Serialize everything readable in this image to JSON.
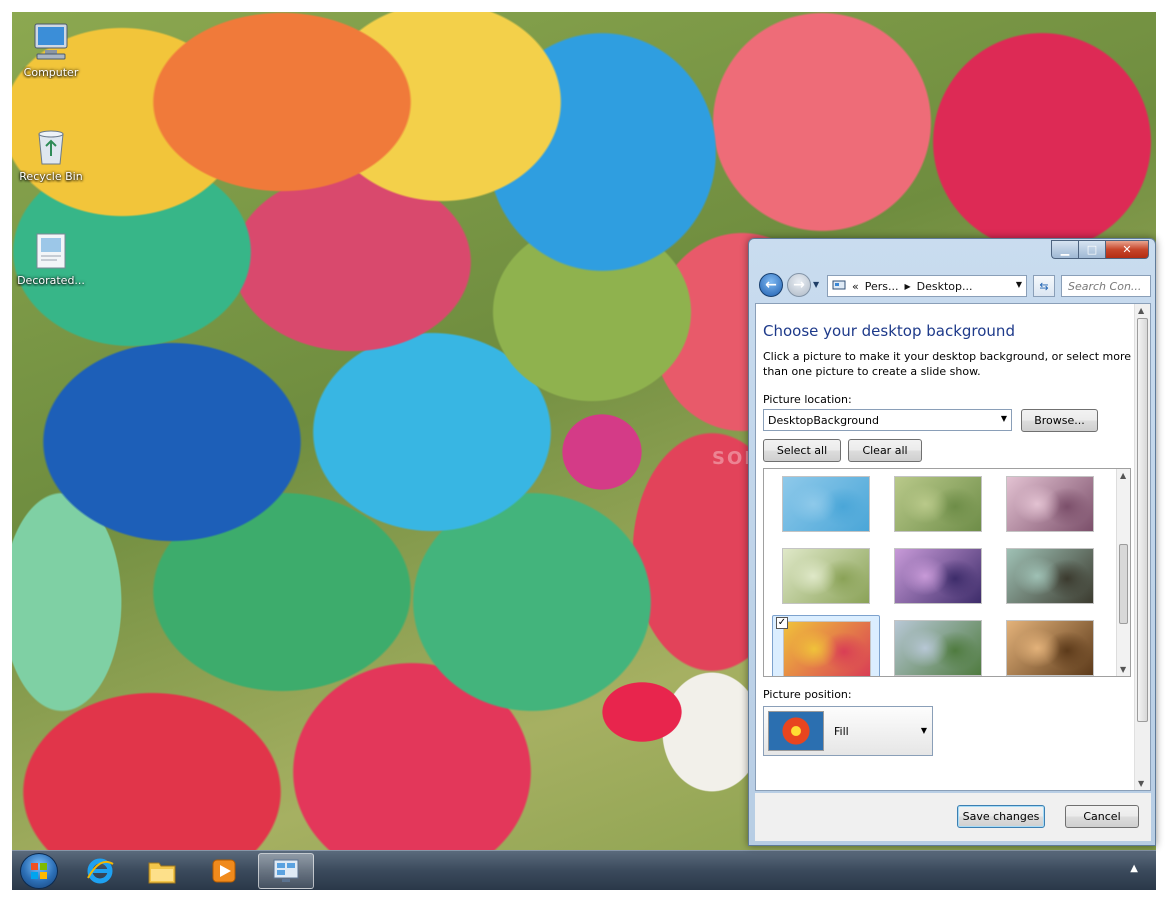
{
  "desktop": {
    "icons": [
      {
        "label": "Computer",
        "icon": "computer-icon"
      },
      {
        "label": "Recycle Bin",
        "icon": "recycle-bin-icon"
      },
      {
        "label": "Decorated...",
        "icon": "folder-icon"
      }
    ],
    "watermark": "SOFT"
  },
  "taskbar": {
    "items": [
      {
        "icon": "start-orb-icon"
      },
      {
        "icon": "internet-explorer-icon"
      },
      {
        "icon": "file-explorer-icon"
      },
      {
        "icon": "media-player-icon"
      },
      {
        "icon": "control-panel-icon",
        "active": true
      }
    ],
    "tray_arrow": "▲"
  },
  "window": {
    "caption_buttons": {
      "minimize": "▁",
      "maximize": "□",
      "close": "✕"
    },
    "address": {
      "prefix": "«",
      "segments": [
        "Pers...",
        "Desktop..."
      ],
      "separator": "▶"
    },
    "search_placeholder": "Search Con...",
    "content": {
      "title": "Choose your desktop background",
      "description": "Click a picture to make it your desktop background, or select more than one picture to create a slide show.",
      "location_label": "Picture location:",
      "location_value": "DesktopBackground",
      "browse_label": "Browse...",
      "select_all_label": "Select all",
      "clear_all_label": "Clear all",
      "thumbnails": [
        {
          "colors": [
            "#8ec9ea",
            "#4aa6d8"
          ],
          "checked": false
        },
        {
          "colors": [
            "#b9c98a",
            "#6e8d48"
          ],
          "checked": false
        },
        {
          "colors": [
            "#e3c2d2",
            "#7b4f6a"
          ],
          "checked": false
        },
        {
          "colors": [
            "#dfe8c8",
            "#8aa257"
          ],
          "checked": false
        },
        {
          "colors": [
            "#c89ad8",
            "#3d2c6a"
          ],
          "checked": false
        },
        {
          "colors": [
            "#9fc1b5",
            "#3b3a2e"
          ],
          "checked": false
        },
        {
          "colors": [
            "#f0c23a",
            "#d93e55"
          ],
          "checked": true
        },
        {
          "colors": [
            "#b7c7d5",
            "#4f7b3f"
          ],
          "checked": false
        },
        {
          "colors": [
            "#e3b27a",
            "#5c3a1a"
          ],
          "checked": false
        }
      ],
      "position_label": "Picture position:",
      "position_value": "Fill"
    },
    "footer": {
      "save_label": "Save changes",
      "cancel_label": "Cancel"
    }
  }
}
